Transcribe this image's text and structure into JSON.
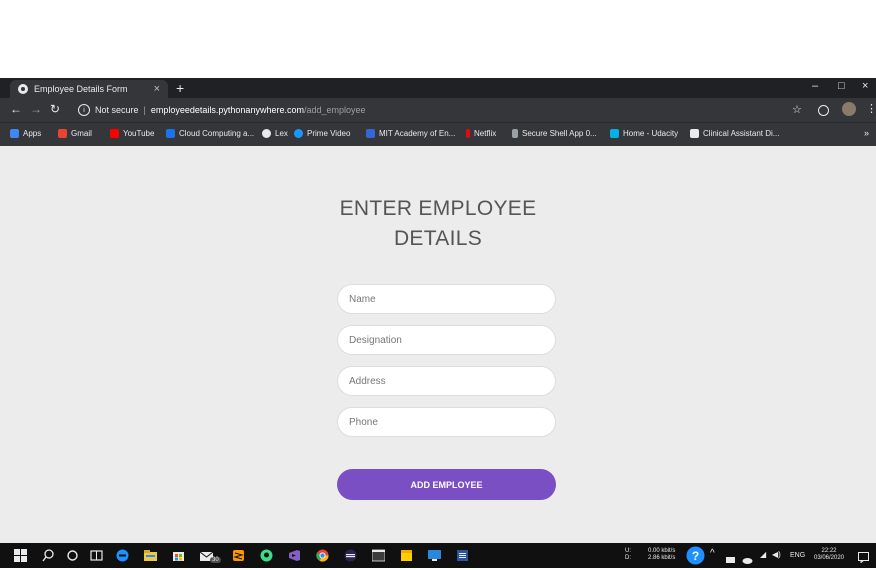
{
  "browser": {
    "tab_title": "Employee Details Form",
    "tab_close": "×",
    "new_tab": "+",
    "window_min": "–",
    "window_max": "□",
    "window_close": "×",
    "address": {
      "security": "Not secure",
      "host": "employeedetails.pythonanywhere.com",
      "path": "/add_employee"
    },
    "bookmarks": [
      {
        "label": "Apps",
        "color": "#4285f4"
      },
      {
        "label": "Gmail",
        "color": "#ea4335"
      },
      {
        "label": "YouTube",
        "color": "#ff0000"
      },
      {
        "label": "Cloud Computing a...",
        "color": "#1a73e8"
      },
      {
        "label": "Lex",
        "color": "#e8eaed"
      },
      {
        "label": "Prime Video",
        "color": "#1a98ff"
      },
      {
        "label": "MIT Academy of En...",
        "color": "#3367d6"
      },
      {
        "label": "Netflix",
        "color": "#e50914"
      },
      {
        "label": "Secure Shell App 0...",
        "color": "#9aa0a6"
      },
      {
        "label": "Home - Udacity",
        "color": "#02b3e4"
      },
      {
        "label": "Clinical Assistant Di...",
        "color": "#e8eaed"
      }
    ]
  },
  "form": {
    "title_line1": "ENTER EMPLOYEE",
    "title_line2": "DETAILS",
    "name_placeholder": "Name",
    "designation_placeholder": "Designation",
    "address_placeholder": "Address",
    "phone_placeholder": "Phone",
    "submit_label": "ADD EMPLOYEE",
    "accent_color": "#7a4fc4"
  },
  "taskbar": {
    "net_up_label": "U:",
    "net_down_label": "D:",
    "net_up": "0.00 kbit/s",
    "net_down": "2.86 kbit/s",
    "language": "ENG",
    "time": "22:22",
    "date": "03/06/2020",
    "badge": "30"
  }
}
